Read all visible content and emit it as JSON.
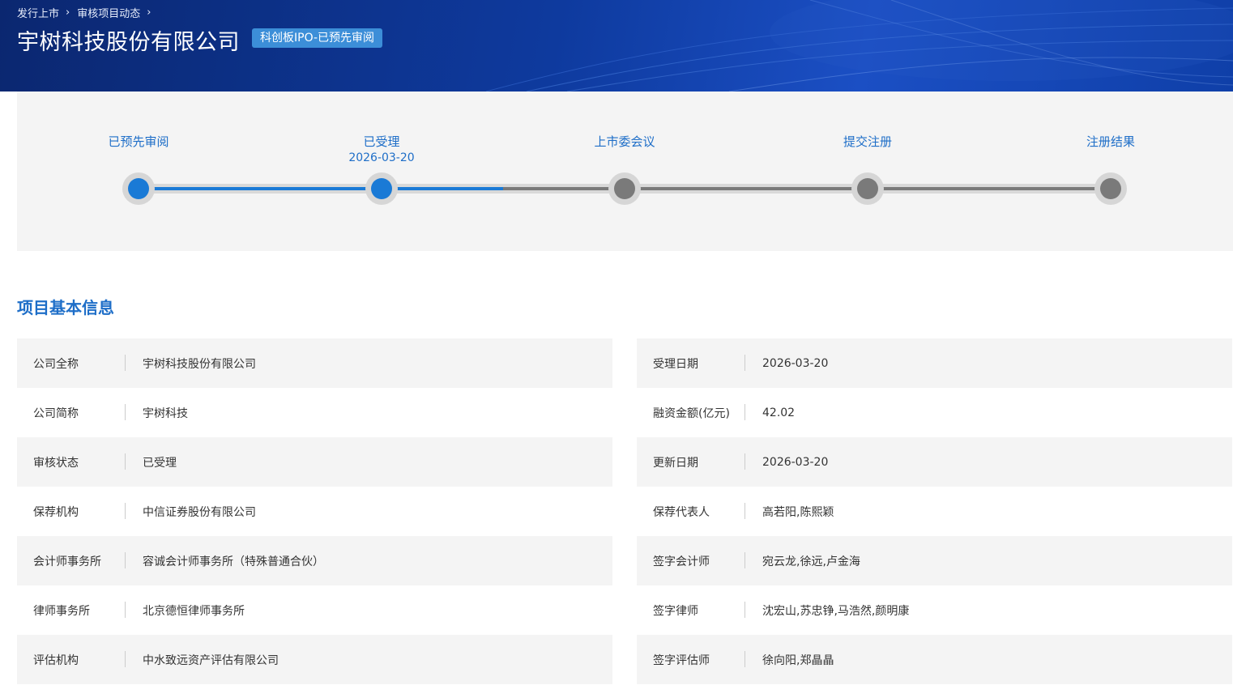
{
  "breadcrumb": [
    "发行上市",
    "审核项目动态"
  ],
  "page_title": "宇树科技股份有限公司",
  "badge": "科创板IPO-已预先审阅",
  "steps": [
    {
      "label": "已预先审阅",
      "date": "",
      "done": true
    },
    {
      "label": "已受理",
      "date": "2026-03-20",
      "done": true
    },
    {
      "label": "上市委会议",
      "date": "",
      "done": false
    },
    {
      "label": "提交注册",
      "date": "",
      "done": false
    },
    {
      "label": "注册结果",
      "date": "",
      "done": false
    }
  ],
  "colors": {
    "active": "#1a7ad6",
    "inactive": "#7a7a7a",
    "track": "#d9d9d9"
  },
  "section_title": "项目基本信息",
  "info_left": [
    {
      "label": "公司全称",
      "value": "宇树科技股份有限公司"
    },
    {
      "label": "公司简称",
      "value": "宇树科技"
    },
    {
      "label": "审核状态",
      "value": "已受理"
    },
    {
      "label": "保荐机构",
      "value": "中信证券股份有限公司"
    },
    {
      "label": "会计师事务所",
      "value": "容诚会计师事务所（特殊普通合伙）"
    },
    {
      "label": "律师事务所",
      "value": "北京德恒律师事务所"
    },
    {
      "label": "评估机构",
      "value": "中水致远资产评估有限公司"
    }
  ],
  "info_right": [
    {
      "label": "受理日期",
      "value": "2026-03-20"
    },
    {
      "label": "融资金额(亿元)",
      "value": "42.02"
    },
    {
      "label": "更新日期",
      "value": "2026-03-20"
    },
    {
      "label": "保荐代表人",
      "value": "高若阳,陈熙颖"
    },
    {
      "label": "签字会计师",
      "value": "宛云龙,徐远,卢金海"
    },
    {
      "label": "签字律师",
      "value": "沈宏山,苏忠铮,马浩然,颜明康"
    },
    {
      "label": "签字评估师",
      "value": "徐向阳,郑晶晶"
    }
  ]
}
